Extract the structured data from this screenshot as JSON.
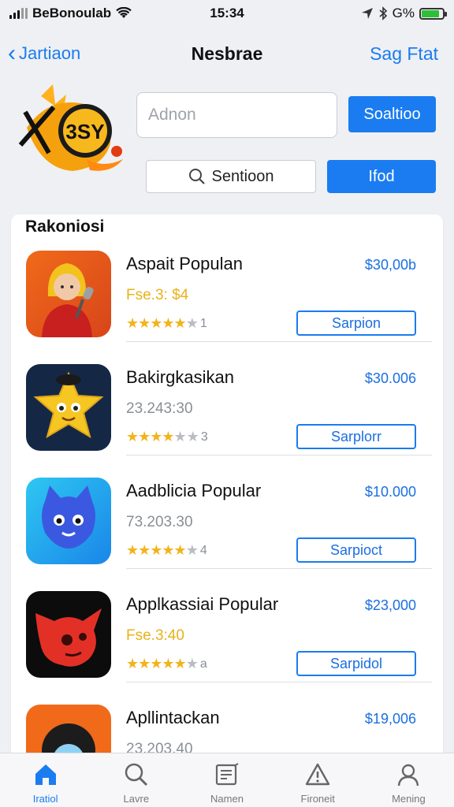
{
  "status_bar": {
    "carrier": "BeBonoulab",
    "time": "15:34",
    "battery_text": "G%"
  },
  "nav": {
    "back_label": "Jartiaon",
    "title": "Nesbrae",
    "action_label": "Sag Ftat"
  },
  "header": {
    "logo_text": "3SY",
    "search_placeholder": "Adnon",
    "search_button_label": "Soaltioo",
    "section_button_label": "Sentioon",
    "find_button_label": "Ifod"
  },
  "list": {
    "title": "Rakoniosi",
    "items": [
      {
        "name": "Aspait Populan",
        "price": "$30,00b",
        "meta": "Fse.3: $4",
        "rating": "1",
        "button_label": "Sarpion"
      },
      {
        "name": "Bakirgkasikan",
        "price": "$30.006",
        "meta": "23.243:30",
        "rating": "3",
        "button_label": "Sarplorr"
      },
      {
        "name": "Aadblicia Popular",
        "price": "$10.000",
        "meta": "73.203.30",
        "rating": "4",
        "button_label": "Sarpioct"
      },
      {
        "name": "Applkassiai Popular",
        "price": "$23,000",
        "meta": "Fse.3:40",
        "rating": "a",
        "button_label": "Sarpidol"
      },
      {
        "name": "Apllintackan",
        "price": "$19,006",
        "meta": "23.203.40"
      }
    ]
  },
  "tabs": [
    {
      "label": "Iratiol",
      "icon": "home-icon",
      "active": true
    },
    {
      "label": "Lavre",
      "icon": "search-icon",
      "active": false
    },
    {
      "label": "Namen",
      "icon": "news-icon",
      "active": false
    },
    {
      "label": "Fironeit",
      "icon": "warning-icon",
      "active": false
    },
    {
      "label": "Mening",
      "icon": "person-icon",
      "active": false
    }
  ],
  "colors": {
    "accent": "#1a7cf0",
    "star": "#f2b31b",
    "price": "#1a6fe0",
    "battery": "#2fbd3a"
  }
}
